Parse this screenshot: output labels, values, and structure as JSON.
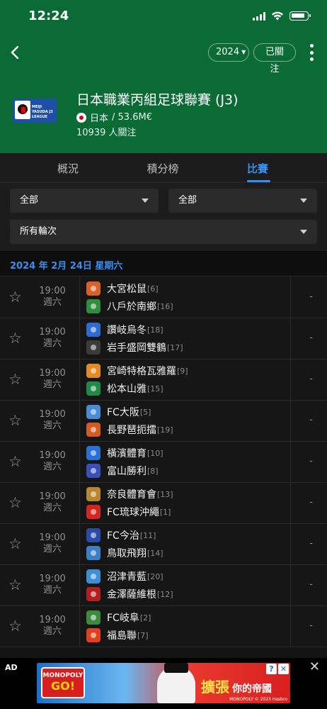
{
  "status_bar": {
    "time": "12:24"
  },
  "topbar": {
    "year": "2024",
    "follow_label": "已關注"
  },
  "league": {
    "logo_text": "MEIJI YASUDA J3 LEAGUE",
    "title": "日本職業丙組足球聯賽 (J3)",
    "country": "日本",
    "value": " / 53.6M€",
    "followers": "10939 人關注"
  },
  "tabs": [
    {
      "label": "概況",
      "active": false
    },
    {
      "label": "積分榜",
      "active": false
    },
    {
      "label": "比賽",
      "active": true
    }
  ],
  "filters": {
    "filter1": "全部",
    "filter2": "全部",
    "round": "所有輪次"
  },
  "date_header": "2024 年 2月 24日  星期六",
  "matches": [
    {
      "time": "19:00",
      "day": "週六",
      "home": "大宮松鼠",
      "home_rank": "[6]",
      "away": "八戶於南鄉",
      "away_rank": "[16]",
      "score": "-",
      "home_color": "#d9612a",
      "away_color": "#2f8d3e"
    },
    {
      "time": "19:00",
      "day": "週六",
      "home": "讚岐烏冬",
      "home_rank": "[18]",
      "away": "岩手盛岡雙鶴",
      "away_rank": "[17]",
      "score": "-",
      "home_color": "#2f6ad0",
      "away_color": "#3b3b3b"
    },
    {
      "time": "19:00",
      "day": "週六",
      "home": "宮崎特格瓦雅羅",
      "home_rank": "[9]",
      "away": "松本山雅",
      "away_rank": "[15]",
      "score": "-",
      "home_color": "#e28a26",
      "away_color": "#1f8a46"
    },
    {
      "time": "19:00",
      "day": "週六",
      "home": "FC大阪",
      "home_rank": "[5]",
      "away": "長野琶扼擂",
      "away_rank": "[19]",
      "score": "-",
      "home_color": "#4a8bd6",
      "away_color": "#d35a25"
    },
    {
      "time": "19:00",
      "day": "週六",
      "home": "橫濱體育",
      "home_rank": "[10]",
      "away": "富山勝利",
      "away_rank": "[8]",
      "score": "-",
      "home_color": "#2a6fd4",
      "away_color": "#3a4fb8"
    },
    {
      "time": "19:00",
      "day": "週六",
      "home": "奈良體育會",
      "home_rank": "[13]",
      "away": "FC琉球沖繩",
      "away_rank": "[1]",
      "score": "-",
      "home_color": "#b8862f",
      "away_color": "#d42323"
    },
    {
      "time": "19:00",
      "day": "週六",
      "home": "FC今治",
      "home_rank": "[11]",
      "away": "鳥取飛翔",
      "away_rank": "[14]",
      "score": "-",
      "home_color": "#2b4aa8",
      "away_color": "#3a7fc4"
    },
    {
      "time": "19:00",
      "day": "週六",
      "home": "沼津青藍",
      "home_rank": "[20]",
      "away": "金澤薩維根",
      "away_rank": "[12]",
      "score": "-",
      "home_color": "#3a8fd6",
      "away_color": "#b02020"
    },
    {
      "time": "19:00",
      "day": "週六",
      "home": "FC岐阜",
      "home_rank": "[2]",
      "away": "福島聯",
      "away_rank": "[7]",
      "score": "-",
      "home_color": "#3c8a3c",
      "away_color": "#e0401f"
    }
  ],
  "ad": {
    "label": "AD",
    "brand_top": "MONOPOLY",
    "brand_bottom": "GO!",
    "headline": "擴張",
    "subline": "你的帝國",
    "copyright": "MONOPOLY © 2023 Hasbro"
  },
  "colors": {
    "header_green": "#0a6b35",
    "accent_blue": "#3a8ef2"
  }
}
